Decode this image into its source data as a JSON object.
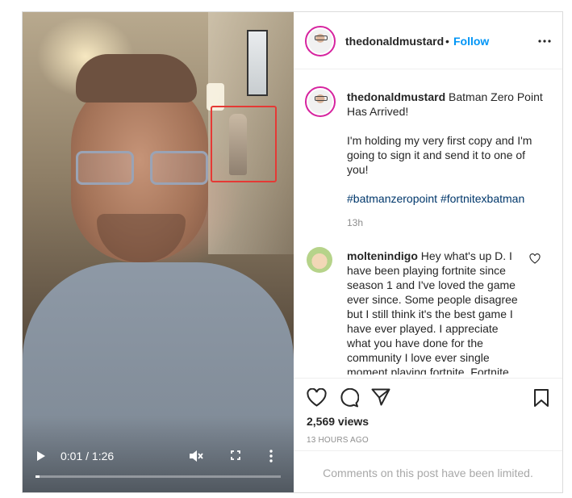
{
  "video": {
    "time": "0:01 / 1:26",
    "progress": 0.016,
    "icons": [
      "play-icon",
      "mute-icon",
      "fullscreen-icon",
      "more-vertical-icon"
    ]
  },
  "header": {
    "username": "thedonaldmustard",
    "separator": "•",
    "follow_label": "Follow"
  },
  "caption": {
    "username": "thedonaldmustard",
    "title": "Batman Zero Point Has Arrived!",
    "body": "I'm holding my very first copy and I'm going to sign it and send it to one of you!",
    "hashtags": [
      "#batmanzeropoint",
      "#fortnitexbatman"
    ],
    "age": "13h"
  },
  "comment": {
    "username": "moltenindigo",
    "text": "Hey what's up D. I have been playing fortnite since season 1 and I've loved the game ever since. Some people disagree but I still think it's the best game I have ever played. I appreciate what you have done for the community I love ever single moment playing fortnite. Fortnite"
  },
  "stats": {
    "views": "2,569 views",
    "posted": "13 HOURS AGO"
  },
  "footer": {
    "limited_text": "Comments on this post have been limited."
  },
  "colors": {
    "follow": "#0095f6",
    "hashtag": "#00376b",
    "highlight_box": "#e53935",
    "muted_text": "#8e8e8e"
  }
}
